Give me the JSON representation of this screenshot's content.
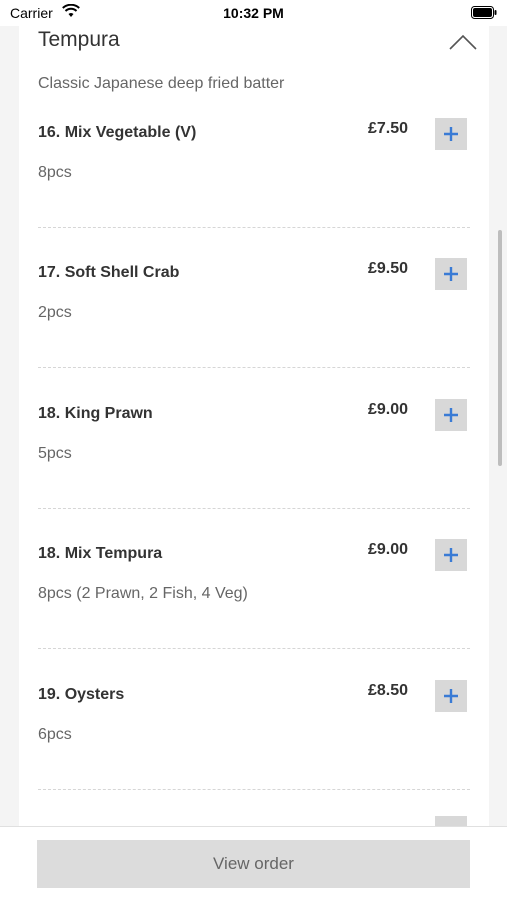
{
  "status_bar": {
    "carrier": "Carrier",
    "time": "10:32 PM"
  },
  "section": {
    "title": "Tempura",
    "description": "Classic Japanese deep fried batter",
    "expanded": true
  },
  "items": [
    {
      "name": "16. Mix Vegetable (V)",
      "detail": "8pcs",
      "price": "£7.50"
    },
    {
      "name": "17. Soft Shell Crab",
      "detail": "2pcs",
      "price": "£9.50"
    },
    {
      "name": "18. King Prawn",
      "detail": "5pcs",
      "price": "£9.00"
    },
    {
      "name": "18. Mix Tempura",
      "detail": "8pcs (2 Prawn, 2 Fish, 4 Veg)",
      "price": "£9.00"
    },
    {
      "name": "19. Oysters",
      "detail": "6pcs",
      "price": "£8.50"
    }
  ],
  "footer": {
    "view_order_label": "View order"
  },
  "colors": {
    "accent": "#3a7bd5",
    "button_bg": "#d8d8d8",
    "divider": "#d6d6d6"
  }
}
